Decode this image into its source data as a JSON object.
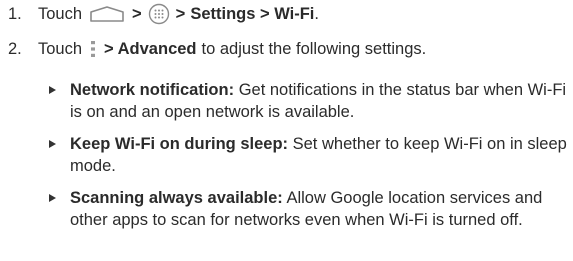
{
  "steps": [
    {
      "number": "1.",
      "prefix": "Touch",
      "icon1": "home-icon",
      "sep1": ">",
      "icon2": "apps-grid-icon",
      "sep2": ">",
      "bold_path": "Settings > Wi-Fi",
      "suffix": "."
    },
    {
      "number": "2.",
      "prefix": "Touch",
      "icon1": "menu-dots-icon",
      "bold_path": "> Advanced",
      "suffix": "to adjust the following settings."
    }
  ],
  "bullets": [
    {
      "term": "Network notification:",
      "text": "Get notifications in the status bar when Wi-Fi is on and an open network is available."
    },
    {
      "term": "Keep Wi-Fi on during sleep:",
      "text": "Set whether to keep Wi-Fi on in sleep mode."
    },
    {
      "term": "Scanning always available:",
      "text": "Allow Google location services and other apps to scan for networks even when Wi-Fi is turned off."
    }
  ],
  "colors": {
    "text": "#2b2b2b",
    "icon": "#8a8a8a"
  }
}
